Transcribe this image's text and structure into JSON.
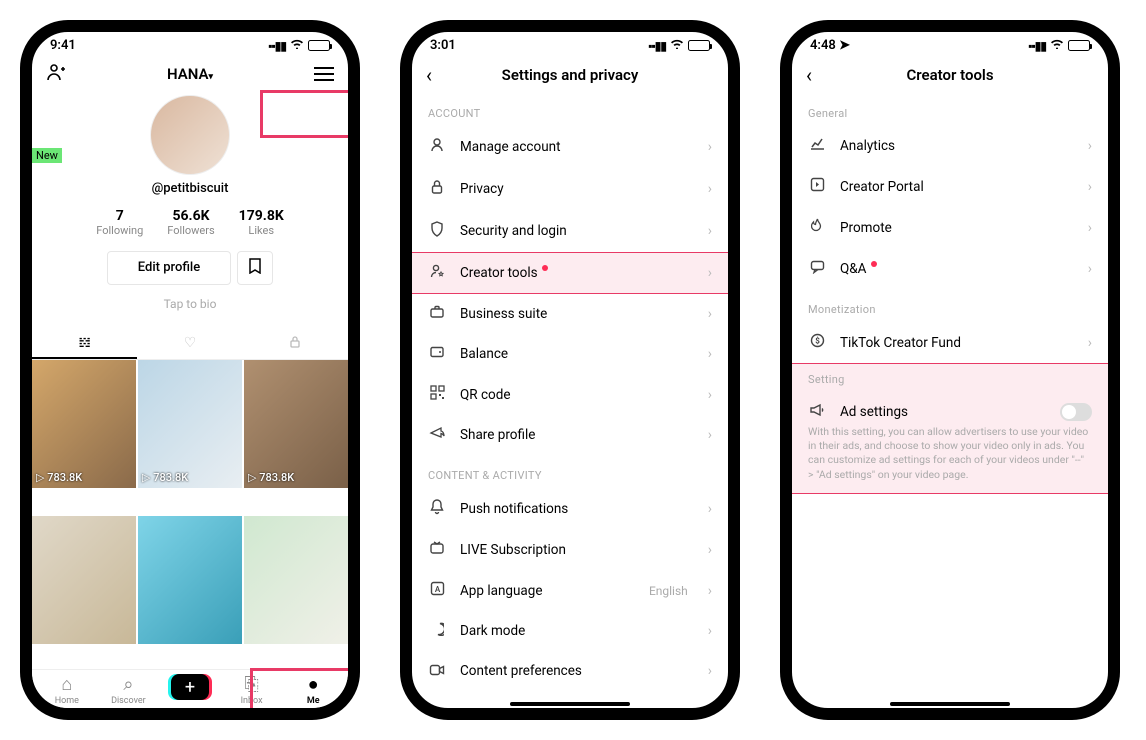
{
  "phone1": {
    "time": "9:41",
    "username_dropdown": "HANA",
    "handle": "@petitbiscuit",
    "stats": {
      "following_num": "7",
      "following_lbl": "Following",
      "followers_num": "56.6K",
      "followers_lbl": "Followers",
      "likes_num": "179.8K",
      "likes_lbl": "Likes"
    },
    "edit_profile": "Edit profile",
    "tap_bio": "Tap to bio",
    "play_count": "783.8K",
    "tabs": {
      "home": "Home",
      "discover": "Discover",
      "inbox": "Inbox",
      "me": "Me"
    },
    "new_badge": "New"
  },
  "phone2": {
    "time": "3:01",
    "title": "Settings and privacy",
    "section_account": "ACCOUNT",
    "section_content": "CONTENT & ACTIVITY",
    "rows": {
      "manage_account": "Manage account",
      "privacy": "Privacy",
      "security": "Security and login",
      "creator_tools": "Creator tools",
      "business_suite": "Business suite",
      "balance": "Balance",
      "qr_code": "QR code",
      "share_profile": "Share profile",
      "push": "Push notifications",
      "live_sub": "LIVE Subscription",
      "app_lang": "App language",
      "app_lang_value": "English",
      "dark_mode": "Dark mode",
      "content_pref": "Content preferences"
    }
  },
  "phone3": {
    "time": "4:48",
    "title": "Creator tools",
    "section_general": "General",
    "section_monetization": "Monetization",
    "section_setting": "Setting",
    "rows": {
      "analytics": "Analytics",
      "creator_portal": "Creator Portal",
      "promote": "Promote",
      "qa": "Q&A",
      "creator_fund": "TikTok Creator Fund",
      "ad_settings": "Ad settings"
    },
    "ad_desc": "With this setting, you can allow advertisers to use your video in their ads, and choose to show your video only in ads. You can customize ad settings for each of your videos under \"--\" > \"Ad settings\" on your video page."
  }
}
